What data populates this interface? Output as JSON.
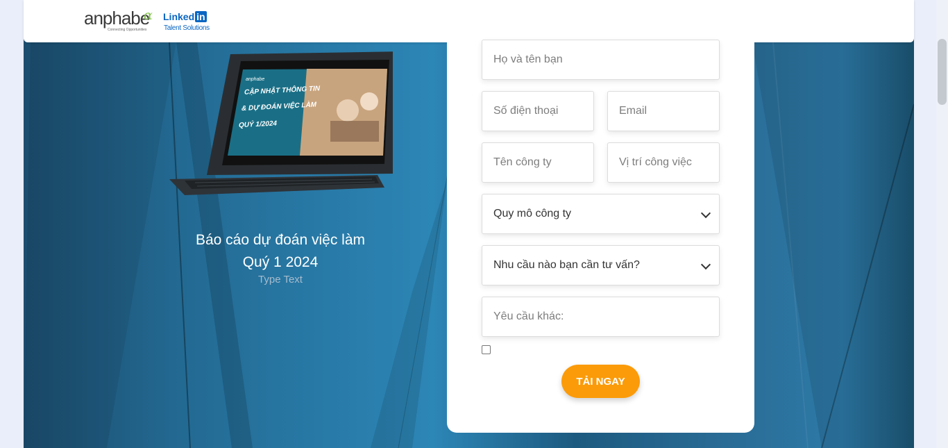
{
  "header": {
    "brand_anphabe": "anphabe",
    "brand_tagline": "Connecting Opportunities",
    "brand_linkedin": "Linked",
    "brand_linkedin_in": "in",
    "brand_talent": "Talent Solutions"
  },
  "promo": {
    "tablet_brand": "anphabe",
    "tablet_line1": "CẬP NHẬT THÔNG TIN",
    "tablet_line2": "& DỰ ĐOÁN VIỆC LÀM",
    "tablet_line3": "QUÝ 1/2024",
    "title_line1": "Báo cáo dự đoán việc làm",
    "title_line2": "Quý 1 2024",
    "subtitle": "Type Text"
  },
  "form": {
    "full_name_placeholder": "Họ và tên bạn",
    "phone_placeholder": "Số điện thoại",
    "email_placeholder": "Email",
    "company_placeholder": "Tên công ty",
    "position_placeholder": "Vị trí công việc",
    "company_size_selected": "Quy mô công ty",
    "need_selected": "Nhu cầu nào bạn cần tư vấn?",
    "other_request_placeholder": "Yêu cầu khác:",
    "consent_checked": false,
    "submit_label": "TẢI NGAY"
  },
  "colors": {
    "accent_button": "#fb9b09",
    "brand_blue": "#0a66c2",
    "background_blue": "#236a93"
  }
}
